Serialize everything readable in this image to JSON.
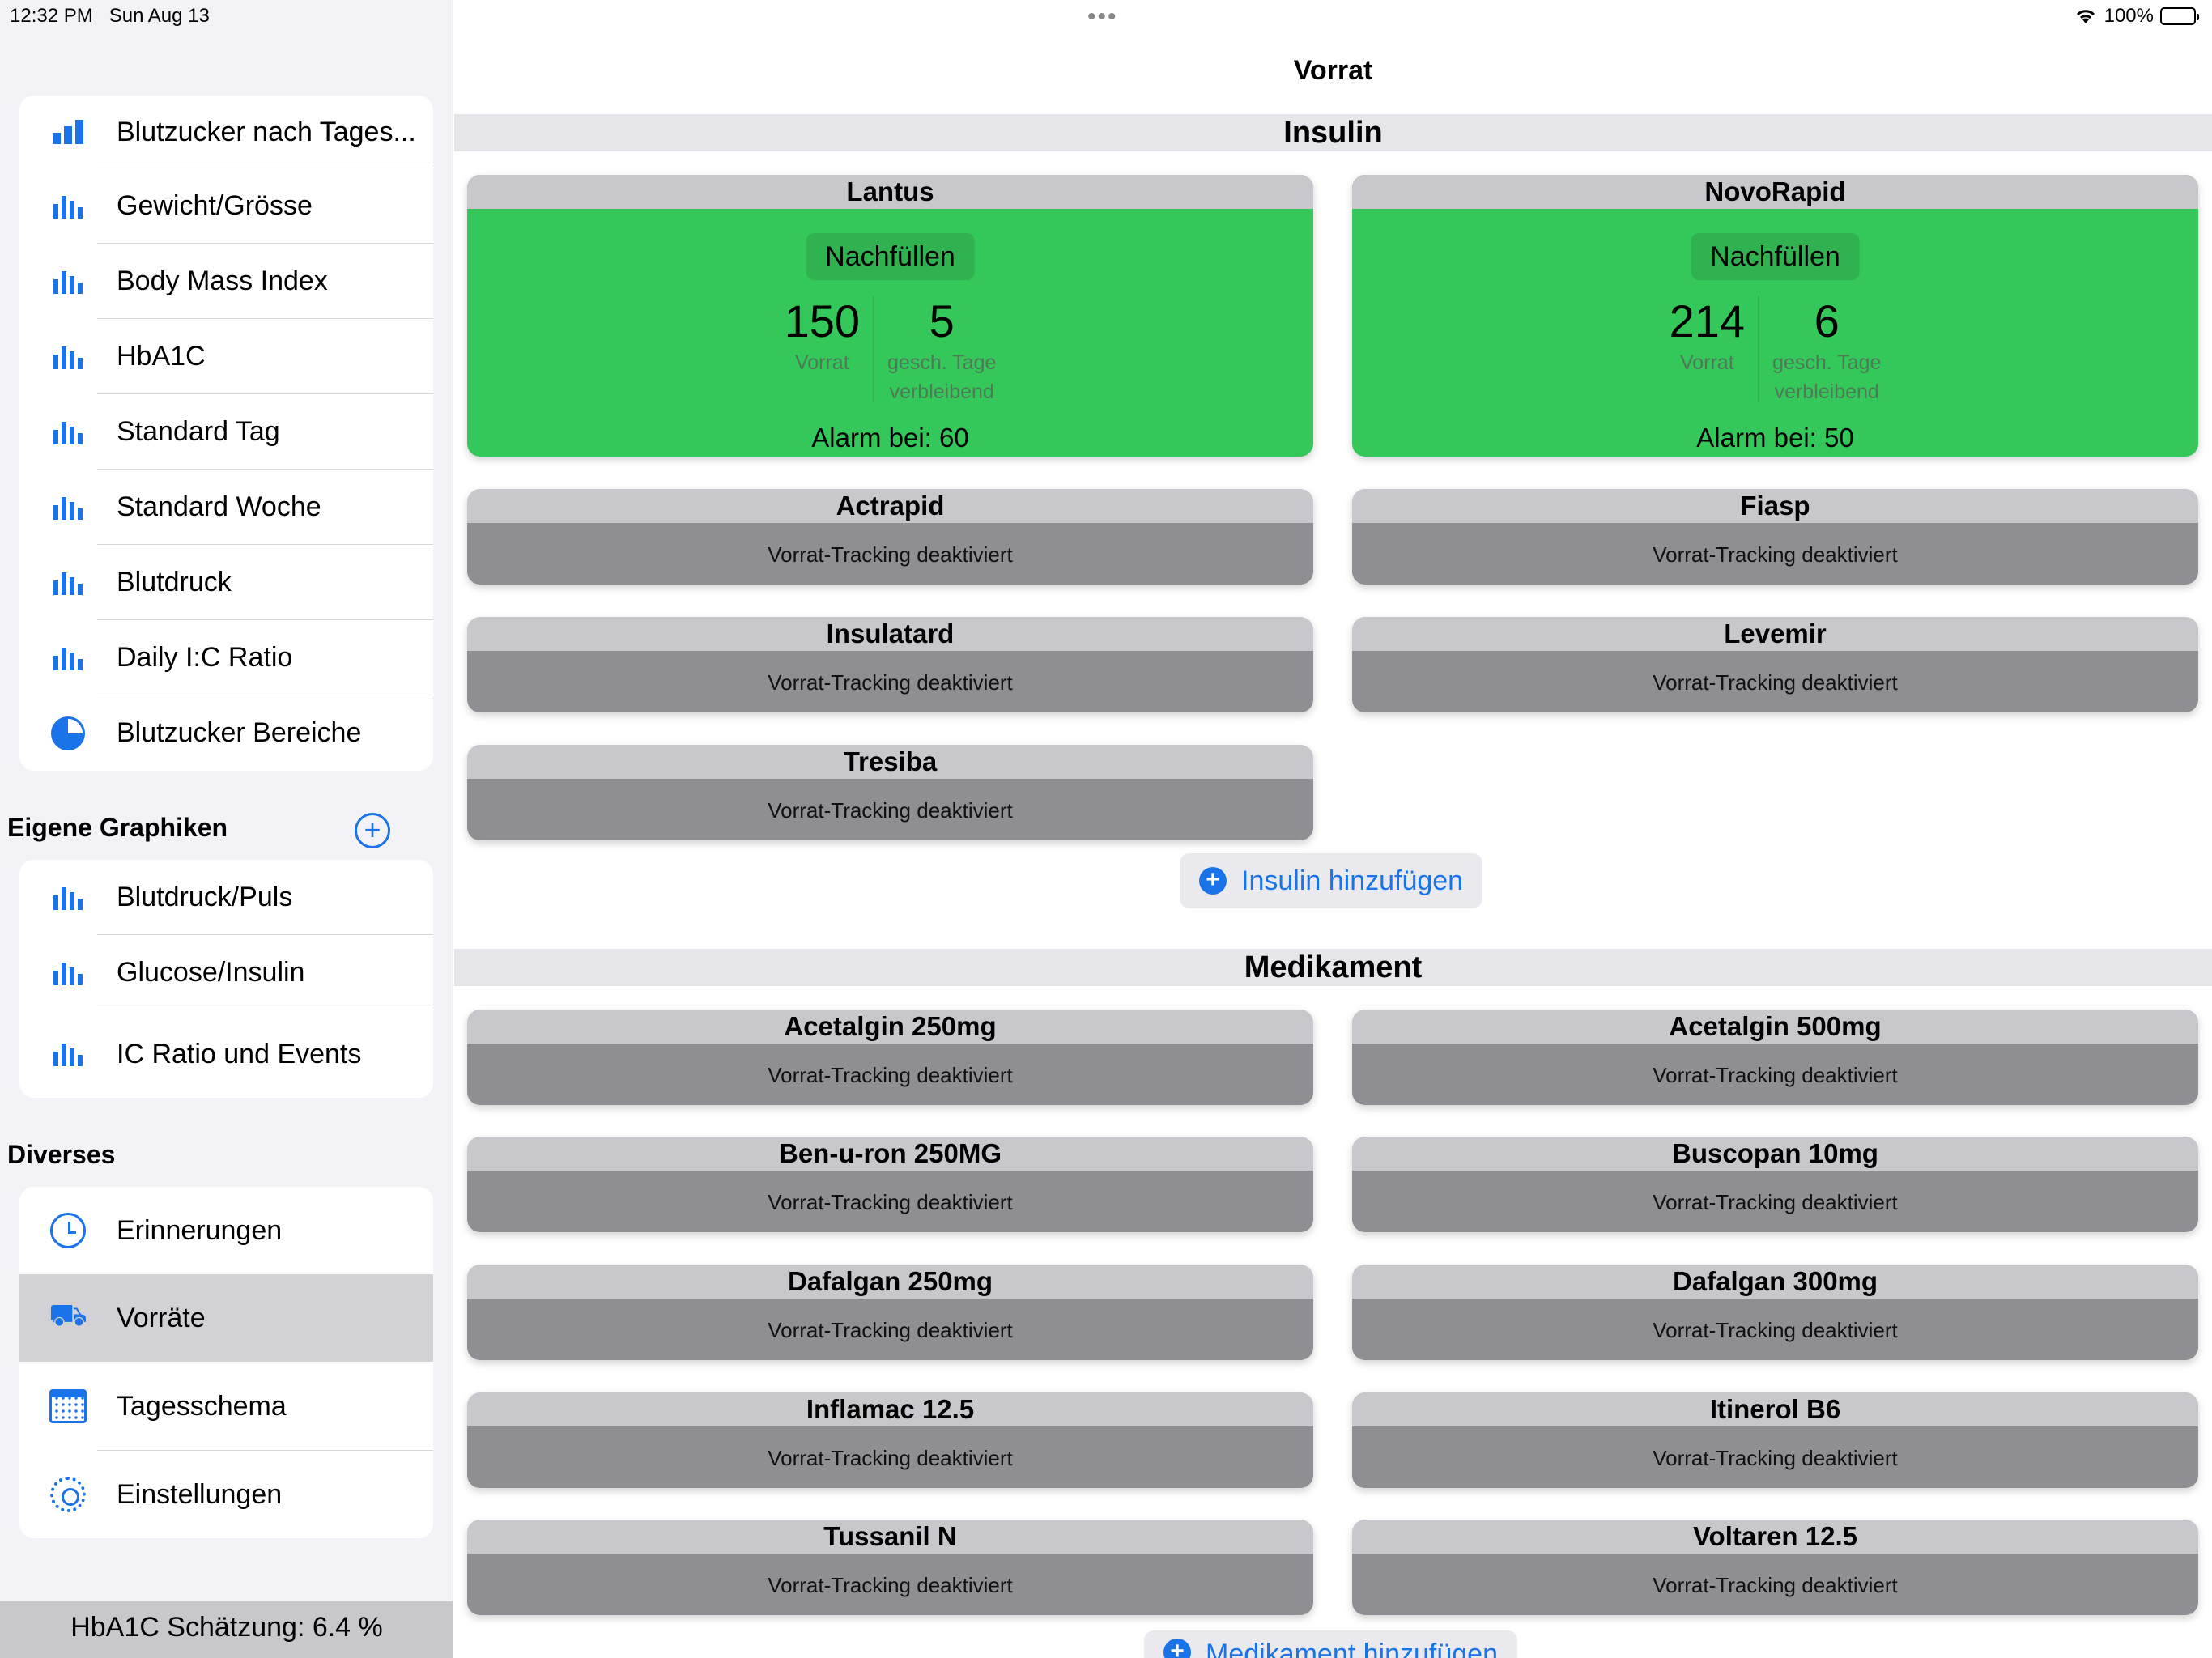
{
  "status_bar": {
    "time": "12:32 PM",
    "date": "Sun Aug 13",
    "battery": "100%"
  },
  "sidebar": {
    "graphs": [
      {
        "label": "Blutzucker nach Tages...",
        "icon": "bar-chart-icon"
      },
      {
        "label": "Gewicht/Grösse",
        "icon": "bar-chart-icon"
      },
      {
        "label": "Body Mass Index",
        "icon": "bar-chart-icon"
      },
      {
        "label": "HbA1C",
        "icon": "bar-chart-icon"
      },
      {
        "label": "Standard Tag",
        "icon": "bar-chart-icon"
      },
      {
        "label": "Standard Woche",
        "icon": "bar-chart-icon"
      },
      {
        "label": "Blutdruck",
        "icon": "bar-chart-icon"
      },
      {
        "label": "Daily I:C Ratio",
        "icon": "bar-chart-icon"
      },
      {
        "label": "Blutzucker Bereiche",
        "icon": "pie-chart-icon"
      }
    ],
    "custom_title": "Eigene Graphiken",
    "custom": [
      {
        "label": "Blutdruck/Puls"
      },
      {
        "label": "Glucose/Insulin"
      },
      {
        "label": "IC Ratio und Events"
      }
    ],
    "misc_title": "Diverses",
    "misc": [
      {
        "label": "Erinnerungen",
        "icon": "alarm-clock-icon"
      },
      {
        "label": "Vorräte",
        "icon": "cart-icon",
        "selected": true
      },
      {
        "label": "Tagesschema",
        "icon": "calendar-icon"
      },
      {
        "label": "Einstellungen",
        "icon": "gear-icon"
      }
    ],
    "footer": "HbA1C Schätzung: 6.4 %"
  },
  "main": {
    "title": "Vorrat",
    "insulin_header": "Insulin",
    "active_insulins": [
      {
        "name": "Lantus",
        "refill": "Nachfüllen",
        "stock": "150",
        "stock_label": "Vorrat",
        "days": "5",
        "days_label_1": "gesch. Tage",
        "days_label_2": "verbleibend",
        "alarm": "Alarm bei: 60"
      },
      {
        "name": "NovoRapid",
        "refill": "Nachfüllen",
        "stock": "214",
        "stock_label": "Vorrat",
        "days": "6",
        "days_label_1": "gesch. Tage",
        "days_label_2": "verbleibend",
        "alarm": "Alarm bei: 50"
      }
    ],
    "tracking_off": "Vorrat-Tracking deaktiviert",
    "inactive_insulins": [
      "Actrapid",
      "Fiasp",
      "Insulatard",
      "Levemir",
      "Tresiba"
    ],
    "add_insulin": "Insulin hinzufügen",
    "medication_header": "Medikament",
    "medications": [
      "Acetalgin 250mg",
      "Acetalgin 500mg",
      "Ben-u-ron 250MG",
      "Buscopan 10mg",
      "Dafalgan 250mg",
      "Dafalgan 300mg",
      "Inflamac 12.5",
      "Itinerol B6",
      "Tussanil N",
      "Voltaren 12.5"
    ],
    "add_medication": "Medikament hinzufügen"
  },
  "colors": {
    "accent": "#1a73e8",
    "active_green": "#34c759",
    "inactive_gray": "#8e8e93"
  }
}
